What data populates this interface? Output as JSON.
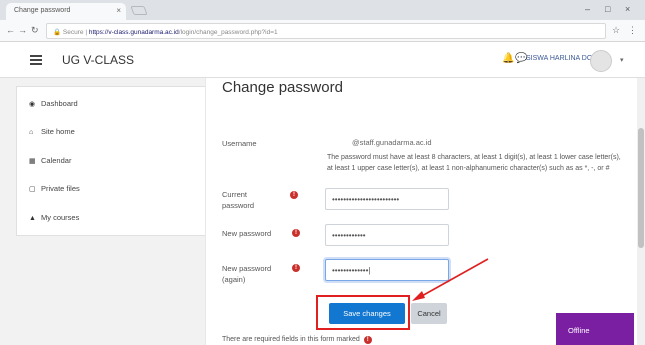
{
  "browser": {
    "tab_title": "Change password",
    "tab_close": "×",
    "url_secure": "Secure",
    "url_host": "https://v-class.gunadarma.ac.id",
    "url_path": "/login/change_password.php?id=1",
    "controls": {
      "minimize": "–",
      "maximize": "□",
      "close": "×"
    }
  },
  "navbar": {
    "brand": "UG V-CLASS",
    "user_name": "SISWA HARLINA DOSEN",
    "caret": "▾"
  },
  "sidebar": {
    "items": [
      {
        "label": "Dashboard",
        "icon": "dashboard-icon",
        "glyph": "◉"
      },
      {
        "label": "Site home",
        "icon": "home-icon",
        "glyph": "⌂"
      },
      {
        "label": "Calendar",
        "icon": "calendar-icon",
        "glyph": "▦"
      },
      {
        "label": "Private files",
        "icon": "file-icon",
        "glyph": "▢"
      },
      {
        "label": "My courses",
        "icon": "graduation-cap-icon",
        "glyph": "▲"
      }
    ]
  },
  "form": {
    "title": "Change password",
    "username_label": "Username",
    "username_value": "@staff.gunadarma.ac.id",
    "policy_text": "The password must have at least 8 characters, at least 1 digit(s), at least 1 lower case letter(s), at least 1 upper case letter(s), at least 1 non-alphanumeric character(s) such as as *, -, or #",
    "current_label_1": "Current",
    "current_label_2": "password",
    "current_value": "••••••••••••••••••••••••",
    "new_label": "New password",
    "new_value": "••••••••••••",
    "repeat_label_1": "New password",
    "repeat_label_2": "(again)",
    "repeat_value": "•••••••••••••|",
    "required_glyph": "!",
    "save_label": "Save changes",
    "cancel_label": "Cancel",
    "footnote": "There are required fields in this form marked"
  },
  "status": {
    "offline_label": "Offline"
  },
  "colors": {
    "primary": "#1177d1",
    "required": "#c9302c",
    "annotation": "#e02020",
    "offline": "#7b1fa2"
  }
}
